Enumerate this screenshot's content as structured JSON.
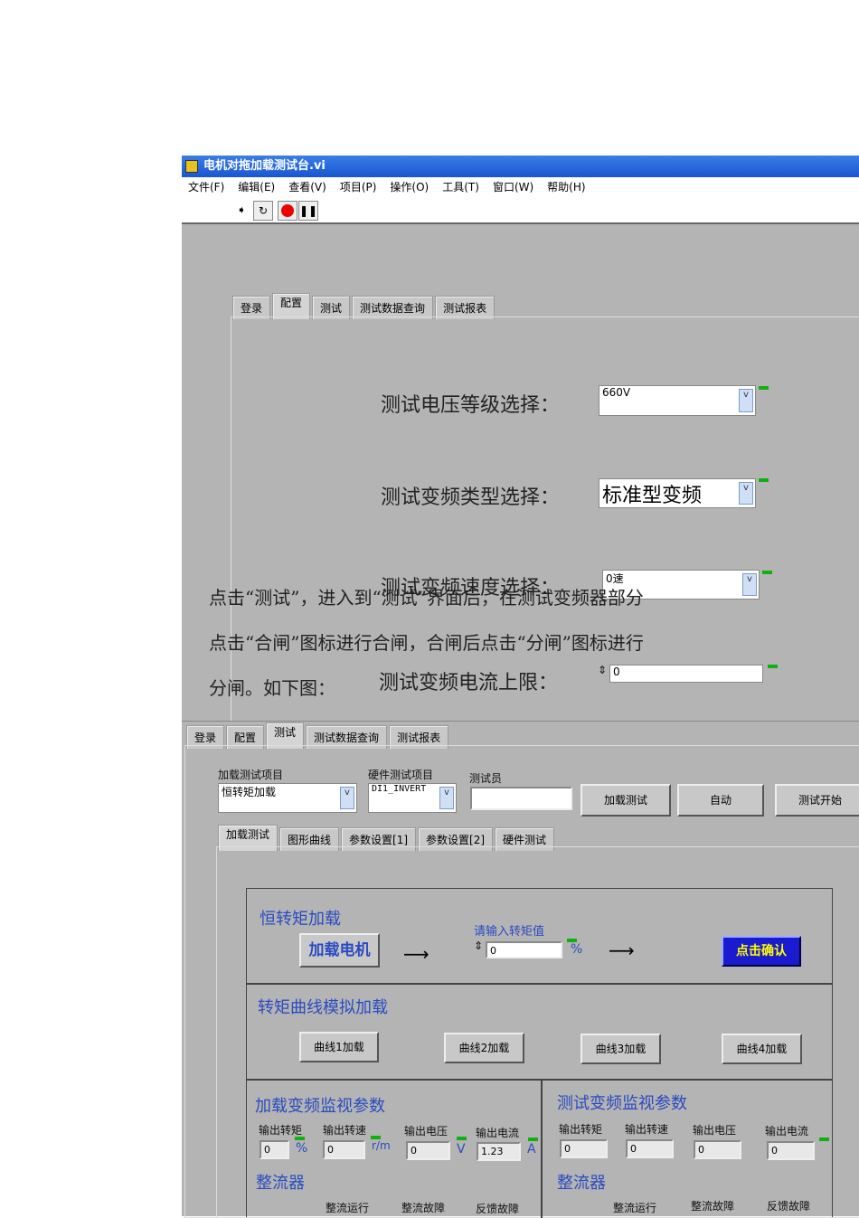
{
  "window": {
    "title": "电机对拖加载测试台.vi",
    "menu": [
      "文件(F)",
      "编辑(E)",
      "查看(V)",
      "项目(P)",
      "操作(O)",
      "工具(T)",
      "窗口(W)",
      "帮助(H)"
    ]
  },
  "top_tabs": [
    "登录",
    "配置",
    "测试",
    "测试数据查询",
    "测试报表"
  ],
  "config": {
    "voltage_label": "测试电压等级选择：",
    "voltage_value": "660V",
    "type_label": "测试变频类型选择：",
    "type_value": "标准型变频",
    "speed_label": "测试变频速度选择：",
    "speed_value": "0速",
    "current_label": "测试变频电流上限：",
    "current_value": "0"
  },
  "doc_text": [
    "点击“测试”，进入到“测试”界面后，在测试变频器部分",
    "点击“合闸”图标进行合闸，合闸后点击“分闸”图标进行",
    "分闸。如下图："
  ],
  "test": {
    "load_item_label": "加载测试项目",
    "load_item_value": "恒转矩加载",
    "hw_item_label": "硬件测试项目",
    "hw_item_value": "DI1_INVERT",
    "tester_label": "测试员",
    "tester_value": "",
    "buttons": [
      "加载测试",
      "自动",
      "测试开始"
    ],
    "sub_tabs": [
      "加载测试",
      "图形曲线",
      "参数设置[1]",
      "参数设置[2]",
      "硬件测试"
    ],
    "const_title": "恒转矩加载",
    "load_motor": "加载电机",
    "torque_prompt": "请输入转矩值",
    "torque_value": "0",
    "torque_unit": "%",
    "confirm": "点击确认",
    "curve_title": "转矩曲线模拟加载",
    "curves": [
      "曲线1加载",
      "曲线2加载",
      "曲线3加载",
      "曲线4加载"
    ],
    "load_monitor": {
      "title": "加载变频监视参数",
      "labels": [
        "输出转矩",
        "输出转速",
        "输出电压",
        "输出电流"
      ],
      "values": [
        "0",
        "0",
        "0",
        "1.23"
      ],
      "units": [
        "%",
        "r/m",
        "V",
        "A"
      ]
    },
    "test_monitor": {
      "title": "测试变频监视参数",
      "labels": [
        "输出转矩",
        "输出转速",
        "输出电压",
        "输出电流"
      ],
      "values": [
        "0",
        "0",
        "0",
        "0"
      ]
    },
    "rectifier_title": "整流器",
    "rect_labels": [
      "整流运行",
      "整流故障",
      "反馈故障"
    ]
  }
}
